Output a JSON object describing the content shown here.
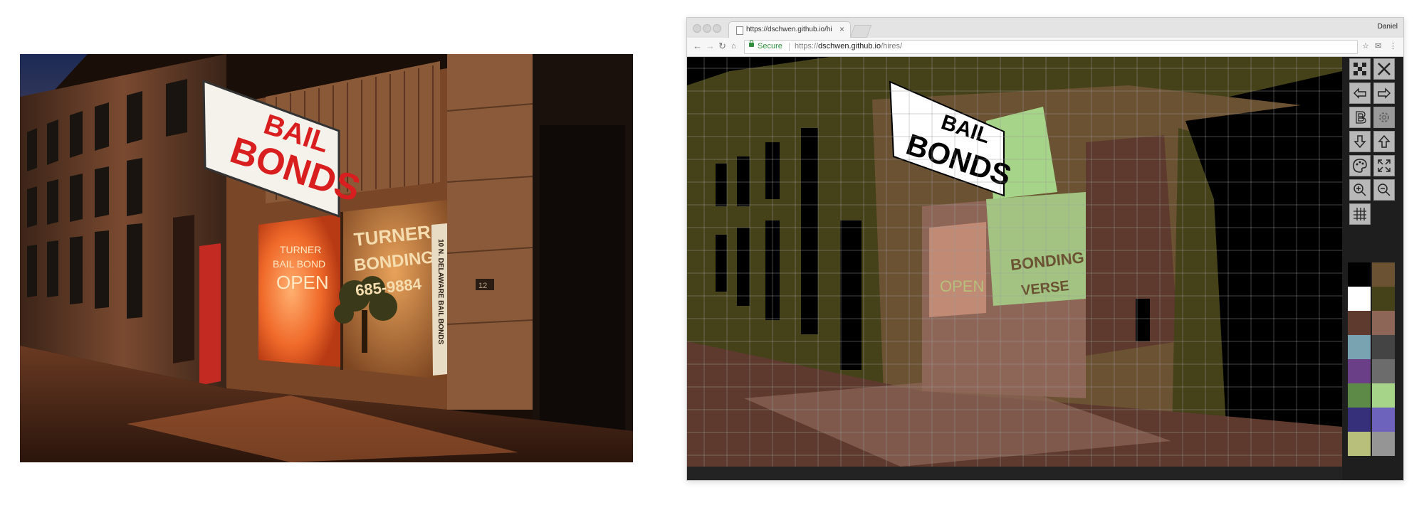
{
  "photo": {
    "sign": {
      "line1": "BAIL",
      "line2": "BONDS"
    },
    "window_left": {
      "line1": "TURNER",
      "line2": "BAIL BOND",
      "line3": "OPEN"
    },
    "window_right": {
      "line1": "TURNER",
      "line2": "BONDING",
      "line3": "685-9884"
    },
    "vertical_sign": "10 N. DELAWARE BAIL BONDS",
    "address_number": "12"
  },
  "browser": {
    "tab": {
      "title": "https://dschwen.github.io/hires/"
    },
    "profile_name": "Daniel",
    "omnibox": {
      "secure_label": "Secure",
      "url_prefix": "https://",
      "url_host": "dschwen.github.io",
      "url_path": "/hires/"
    },
    "canvas_overlay": {
      "sign_line1": "BAIL",
      "sign_line2": "BONDS",
      "window_left": "OPEN",
      "window_right_1": "BONDING",
      "window_right_2": "VERSE"
    }
  },
  "tools": [
    {
      "name": "pixel-grid-icon"
    },
    {
      "name": "close-icon"
    },
    {
      "name": "undo-icon"
    },
    {
      "name": "redo-icon"
    },
    {
      "name": "bold-b-icon"
    },
    {
      "name": "settings-gear-icon"
    },
    {
      "name": "import-icon"
    },
    {
      "name": "export-icon"
    },
    {
      "name": "palette-icon"
    },
    {
      "name": "fullscreen-icon"
    },
    {
      "name": "zoom-in-icon"
    },
    {
      "name": "zoom-out-icon"
    },
    {
      "name": "grid-toggle-icon"
    }
  ],
  "palette": [
    "#000000",
    "#6b5232",
    "#ffffff",
    "#45421a",
    "#5e3a2e",
    "#8d6658",
    "#79a3b0",
    "#444444",
    "#6b3f87",
    "#6c6c6c",
    "#5e8a48",
    "#a6d489",
    "#36307a",
    "#6d63bd",
    "#b7bf7a",
    "#959595"
  ]
}
